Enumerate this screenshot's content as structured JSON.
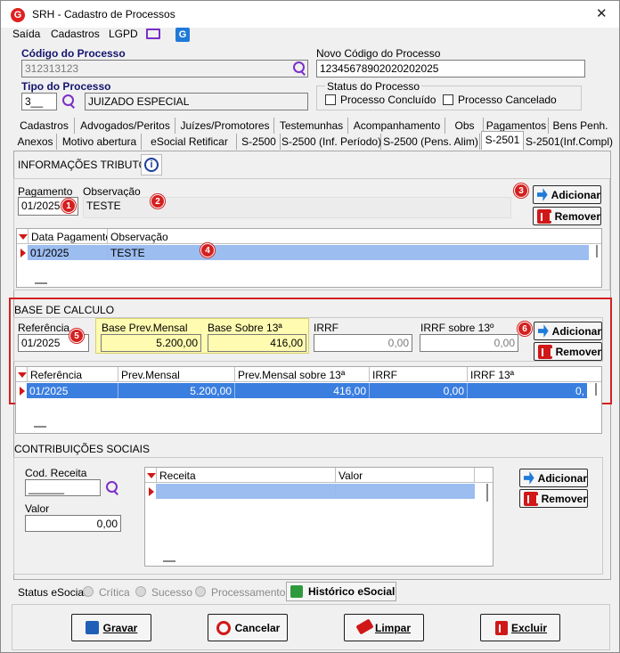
{
  "window": {
    "title": "SRH - Cadastro de Processos",
    "close": "✕"
  },
  "menu": [
    "Saída",
    "Cadastros",
    "LGPD"
  ],
  "codigo": {
    "label": "Código do Processo",
    "value": "312313123"
  },
  "novo_codigo": {
    "label": "Novo Código do Processo",
    "value": "12345678902020202025"
  },
  "tipo": {
    "label": "Tipo do Processo",
    "code": "3__",
    "desc": "JUIZADO ESPECIAL"
  },
  "status_processo": {
    "legend": "Status do Processo",
    "concluido": "Processo Concluído",
    "cancelado": "Processo Cancelado"
  },
  "tabs_row1": [
    "Cadastros",
    "Advogados/Peritos",
    "Juízes/Promotores",
    "Testemunhas",
    "Acompanhamento",
    "Obs",
    "Pagamentos",
    "Bens Penh."
  ],
  "tabs_row2": [
    "Anexos",
    "Motivo abertura",
    "eSocial Retificar",
    "S-2500",
    "S-2500 (Inf. Período)",
    "S-2500 (Pens. Alim)",
    "S-2501",
    "S-2501(Inf.Compl)"
  ],
  "info_tributo": {
    "label": "INFORMAÇÕES TRIBUTO",
    "info_icon": "i"
  },
  "pagamento": {
    "label": "Pagamento",
    "value": "01/2025",
    "obs_label": "Observação",
    "obs_value": "TESTE"
  },
  "buttons": {
    "adicionar": "Adicionar",
    "remover": "Remover"
  },
  "badges": [
    "1",
    "2",
    "3",
    "4",
    "5",
    "6"
  ],
  "grid_pagamento": {
    "headers": [
      "Data Pagamento",
      "Observação"
    ],
    "rows": [
      [
        "01/2025",
        "TESTE"
      ]
    ]
  },
  "base_calculo": {
    "label": "BASE DE CALCULO",
    "referencia_label": "Referência",
    "referencia": "01/2025",
    "base_prev_label": "Base Prev.Mensal",
    "base_prev": "5.200,00",
    "base_13_label": "Base Sobre 13ª",
    "base_13": "416,00",
    "irrf_label": "IRRF",
    "irrf": "0,00",
    "irrf13_label": "IRRF sobre 13º",
    "irrf13": "0,00"
  },
  "grid_base": {
    "headers": [
      "Referência",
      "Prev.Mensal",
      "Prev.Mensal sobre 13ª",
      "IRRF",
      "IRRF 13ª"
    ],
    "rows": [
      [
        "01/2025",
        "5.200,00",
        "416,00",
        "0,00",
        "0,"
      ]
    ]
  },
  "contribuicoes": {
    "label": "CONTRIBUIÇÕES SOCIAIS",
    "cod_label": "Cod. Receita",
    "cod_value": "______",
    "valor_label": "Valor",
    "valor": "0,00"
  },
  "grid_contrib": {
    "headers": [
      "Receita",
      "Valor"
    ]
  },
  "status_esocial": {
    "label": "Status eSocial:",
    "critica": "Crítica",
    "sucesso": "Sucesso",
    "processamento": "Processamento",
    "historico": "Histórico eSocial"
  },
  "footer": {
    "gravar": "Gravar",
    "cancelar": "Cancelar",
    "limpar": "Limpar",
    "excluir": "Excluir"
  },
  "colors": {
    "highlight_red": "#d42020",
    "highlight_yellow": "#fffbb0",
    "row_blue": "#9cbdf0",
    "row_blue_dark": "#3a7ee0"
  }
}
